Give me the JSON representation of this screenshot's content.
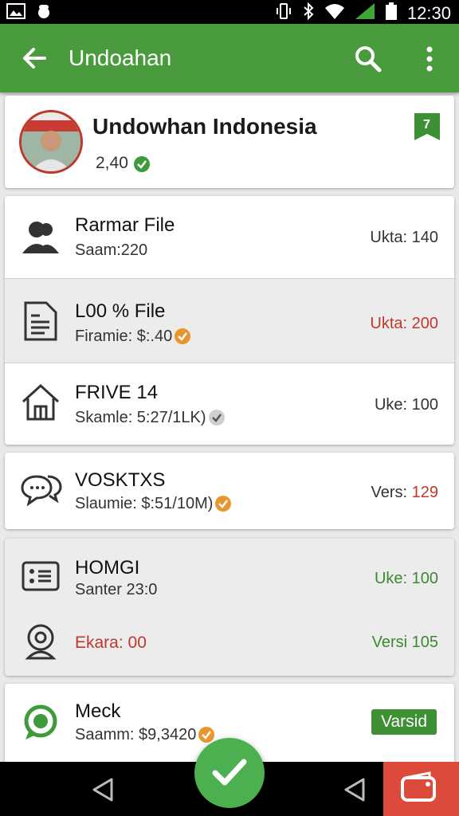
{
  "appbar": {
    "title": "Undoahan"
  },
  "status": {
    "time": "12:30"
  },
  "profile": {
    "name": "Undowhan Indonesia",
    "count": "2,40",
    "bookmark_label": "7"
  },
  "items": [
    {
      "title": "Rarmar File",
      "subtitle": "Saam:220",
      "right": "Ukta: 140"
    },
    {
      "title": "L00 % File",
      "subtitle": "Firamie: $:.40",
      "right": "Ukta: 200"
    },
    {
      "title": "FRIVE 14",
      "subtitle": "Skamle: 5:27/1LK)",
      "right": "Uke: 100"
    },
    {
      "title": "VOSKTXS",
      "subtitle": "Slaumie: $:51/10M)",
      "right_label": "Vers:",
      "right_value": "129"
    },
    {
      "title": "HOMGI",
      "subtitle": "Santer 23:0",
      "right": "Uke: 100"
    },
    {
      "title": "Ekara: 00",
      "right": "Versi 105"
    },
    {
      "title": "Meck",
      "subtitle": "Saamm: $9,3420",
      "badge": "Varsid"
    }
  ],
  "colors": {
    "primary": "#4a9b3d",
    "accent_red": "#c0382b",
    "fab": "#4caf50",
    "check_orange": "#e8962e"
  }
}
